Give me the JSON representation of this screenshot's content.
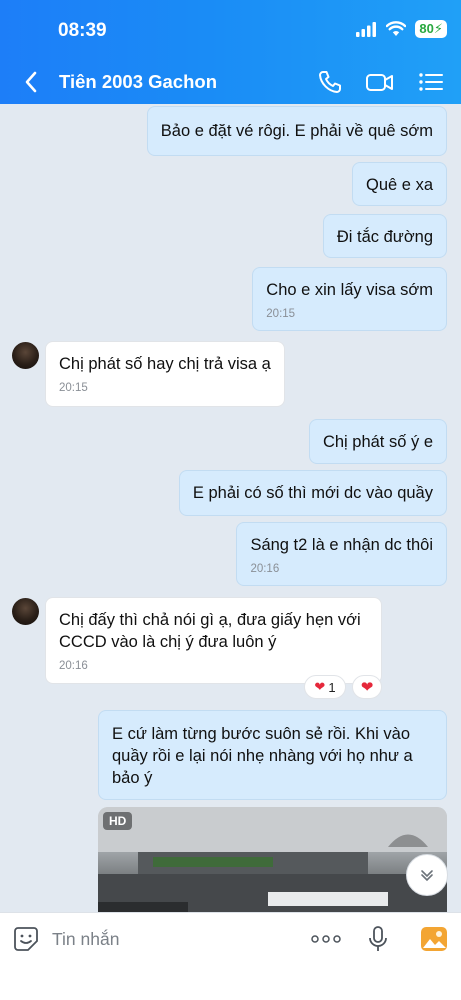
{
  "status": {
    "time": "08:39",
    "battery": "80"
  },
  "header": {
    "title": "Tiên 2003 Gachon"
  },
  "messages": [
    {
      "text": "Bảo e đặt vé rôgi. E phải về quê sớm"
    },
    {
      "text": "Quê e xa"
    },
    {
      "text": "Đi tắc đường"
    },
    {
      "text": "Cho e xin lấy visa sớm",
      "time": "20:15"
    },
    {
      "text": "Chị phát số hay chị trả visa ạ",
      "time": "20:15"
    },
    {
      "text": "Chị phát số ý e"
    },
    {
      "text": "E phải có số thì mới dc vào quầy"
    },
    {
      "text": "Sáng t2 là e nhận dc thôi",
      "time": "20:16"
    },
    {
      "text": "Chị đấy thì chả nói gì ạ, đưa giấy hẹn với CCCD vào là chị ý đưa luôn ý",
      "time": "20:16"
    },
    {
      "text": "E cứ làm từng bước suôn sẻ rồi. Khi vào quầy rồi e lại nói nhẹ nhàng với họ như a bảo ý"
    }
  ],
  "reaction": {
    "count": "1"
  },
  "photo": {
    "badge": "HD"
  },
  "composer": {
    "placeholder": "Tin nhắn"
  }
}
